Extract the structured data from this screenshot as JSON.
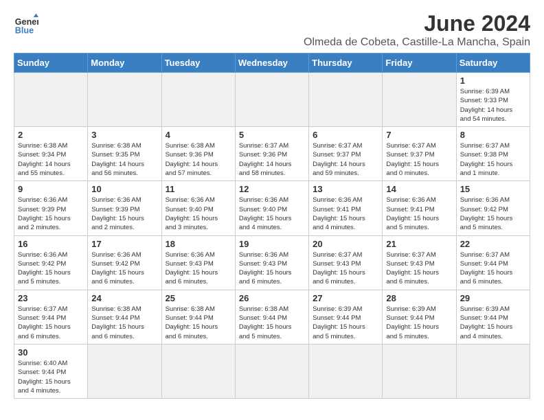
{
  "header": {
    "logo_general": "General",
    "logo_blue": "Blue",
    "title": "June 2024",
    "subtitle": "Olmeda de Cobeta, Castille-La Mancha, Spain"
  },
  "weekdays": [
    "Sunday",
    "Monday",
    "Tuesday",
    "Wednesday",
    "Thursday",
    "Friday",
    "Saturday"
  ],
  "weeks": [
    [
      {
        "day": "",
        "info": "",
        "empty": true
      },
      {
        "day": "",
        "info": "",
        "empty": true
      },
      {
        "day": "",
        "info": "",
        "empty": true
      },
      {
        "day": "",
        "info": "",
        "empty": true
      },
      {
        "day": "",
        "info": "",
        "empty": true
      },
      {
        "day": "",
        "info": "",
        "empty": true
      },
      {
        "day": "1",
        "info": "Sunrise: 6:39 AM\nSunset: 9:33 PM\nDaylight: 14 hours\nand 54 minutes."
      }
    ],
    [
      {
        "day": "2",
        "info": "Sunrise: 6:38 AM\nSunset: 9:34 PM\nDaylight: 14 hours\nand 55 minutes."
      },
      {
        "day": "3",
        "info": "Sunrise: 6:38 AM\nSunset: 9:35 PM\nDaylight: 14 hours\nand 56 minutes."
      },
      {
        "day": "4",
        "info": "Sunrise: 6:38 AM\nSunset: 9:36 PM\nDaylight: 14 hours\nand 57 minutes."
      },
      {
        "day": "5",
        "info": "Sunrise: 6:37 AM\nSunset: 9:36 PM\nDaylight: 14 hours\nand 58 minutes."
      },
      {
        "day": "6",
        "info": "Sunrise: 6:37 AM\nSunset: 9:37 PM\nDaylight: 14 hours\nand 59 minutes."
      },
      {
        "day": "7",
        "info": "Sunrise: 6:37 AM\nSunset: 9:37 PM\nDaylight: 15 hours\nand 0 minutes."
      },
      {
        "day": "8",
        "info": "Sunrise: 6:37 AM\nSunset: 9:38 PM\nDaylight: 15 hours\nand 1 minute."
      }
    ],
    [
      {
        "day": "9",
        "info": "Sunrise: 6:36 AM\nSunset: 9:39 PM\nDaylight: 15 hours\nand 2 minutes."
      },
      {
        "day": "10",
        "info": "Sunrise: 6:36 AM\nSunset: 9:39 PM\nDaylight: 15 hours\nand 2 minutes."
      },
      {
        "day": "11",
        "info": "Sunrise: 6:36 AM\nSunset: 9:40 PM\nDaylight: 15 hours\nand 3 minutes."
      },
      {
        "day": "12",
        "info": "Sunrise: 6:36 AM\nSunset: 9:40 PM\nDaylight: 15 hours\nand 4 minutes."
      },
      {
        "day": "13",
        "info": "Sunrise: 6:36 AM\nSunset: 9:41 PM\nDaylight: 15 hours\nand 4 minutes."
      },
      {
        "day": "14",
        "info": "Sunrise: 6:36 AM\nSunset: 9:41 PM\nDaylight: 15 hours\nand 5 minutes."
      },
      {
        "day": "15",
        "info": "Sunrise: 6:36 AM\nSunset: 9:42 PM\nDaylight: 15 hours\nand 5 minutes."
      }
    ],
    [
      {
        "day": "16",
        "info": "Sunrise: 6:36 AM\nSunset: 9:42 PM\nDaylight: 15 hours\nand 5 minutes."
      },
      {
        "day": "17",
        "info": "Sunrise: 6:36 AM\nSunset: 9:42 PM\nDaylight: 15 hours\nand 6 minutes."
      },
      {
        "day": "18",
        "info": "Sunrise: 6:36 AM\nSunset: 9:43 PM\nDaylight: 15 hours\nand 6 minutes."
      },
      {
        "day": "19",
        "info": "Sunrise: 6:36 AM\nSunset: 9:43 PM\nDaylight: 15 hours\nand 6 minutes."
      },
      {
        "day": "20",
        "info": "Sunrise: 6:37 AM\nSunset: 9:43 PM\nDaylight: 15 hours\nand 6 minutes."
      },
      {
        "day": "21",
        "info": "Sunrise: 6:37 AM\nSunset: 9:43 PM\nDaylight: 15 hours\nand 6 minutes."
      },
      {
        "day": "22",
        "info": "Sunrise: 6:37 AM\nSunset: 9:44 PM\nDaylight: 15 hours\nand 6 minutes."
      }
    ],
    [
      {
        "day": "23",
        "info": "Sunrise: 6:37 AM\nSunset: 9:44 PM\nDaylight: 15 hours\nand 6 minutes."
      },
      {
        "day": "24",
        "info": "Sunrise: 6:38 AM\nSunset: 9:44 PM\nDaylight: 15 hours\nand 6 minutes."
      },
      {
        "day": "25",
        "info": "Sunrise: 6:38 AM\nSunset: 9:44 PM\nDaylight: 15 hours\nand 6 minutes."
      },
      {
        "day": "26",
        "info": "Sunrise: 6:38 AM\nSunset: 9:44 PM\nDaylight: 15 hours\nand 5 minutes."
      },
      {
        "day": "27",
        "info": "Sunrise: 6:39 AM\nSunset: 9:44 PM\nDaylight: 15 hours\nand 5 minutes."
      },
      {
        "day": "28",
        "info": "Sunrise: 6:39 AM\nSunset: 9:44 PM\nDaylight: 15 hours\nand 5 minutes."
      },
      {
        "day": "29",
        "info": "Sunrise: 6:39 AM\nSunset: 9:44 PM\nDaylight: 15 hours\nand 4 minutes."
      }
    ],
    [
      {
        "day": "30",
        "info": "Sunrise: 6:40 AM\nSunset: 9:44 PM\nDaylight: 15 hours\nand 4 minutes."
      },
      {
        "day": "",
        "info": "",
        "empty": true
      },
      {
        "day": "",
        "info": "",
        "empty": true
      },
      {
        "day": "",
        "info": "",
        "empty": true
      },
      {
        "day": "",
        "info": "",
        "empty": true
      },
      {
        "day": "",
        "info": "",
        "empty": true
      },
      {
        "day": "",
        "info": "",
        "empty": true
      }
    ]
  ]
}
